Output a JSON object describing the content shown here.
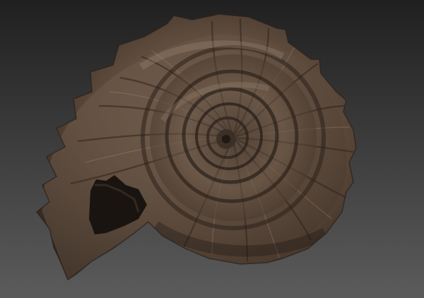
{
  "scene": {
    "subject": "ammonite-fossil-shell",
    "background_top_color": "#202020",
    "background_bottom_color": "#5b5b5b",
    "shell_base_color": "#5e4b3c",
    "shell_light_color": "#8a7462",
    "shell_dark_color": "#2c221b",
    "opening_color": "#1a1410"
  }
}
